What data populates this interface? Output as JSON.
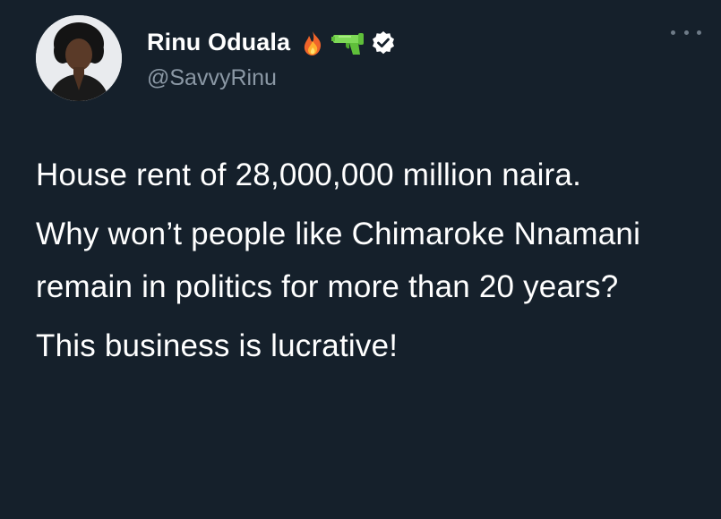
{
  "author": {
    "display_name": "Rinu Oduala",
    "handle": "@SavvyRinu",
    "badges": [
      "fire-icon",
      "water-pistol-icon",
      "verified-badge-icon"
    ]
  },
  "menu": {
    "more_icon": "more-options-icon"
  },
  "tweet": {
    "paragraphs": [
      "House rent of 28,000,000 million naira.",
      "Why won’t people like Chimaroke Nnamani remain in politics for more than 20 years?",
      "This business is lucrative!"
    ]
  },
  "colors": {
    "background": "#15202b",
    "text_primary": "#ffffff",
    "text_secondary": "#8b98a5",
    "verified_badge": "#ffffff"
  }
}
